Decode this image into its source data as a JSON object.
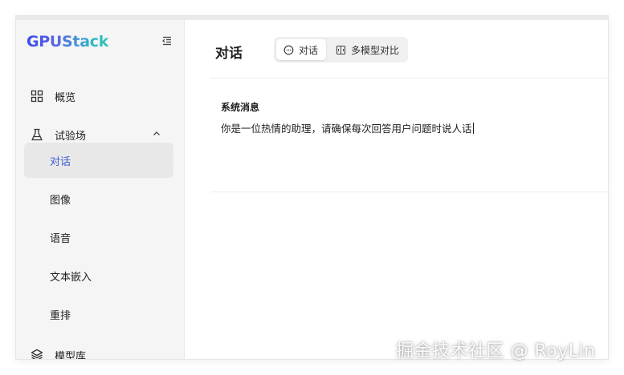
{
  "app": {
    "logo": "GPUStack"
  },
  "sidebar": {
    "items": [
      {
        "label": "概览",
        "icon": "grid-icon"
      },
      {
        "label": "试验场",
        "icon": "flask-icon",
        "expanded": true,
        "children": [
          {
            "label": "对话",
            "active": true
          },
          {
            "label": "图像"
          },
          {
            "label": "语音"
          },
          {
            "label": "文本嵌入"
          },
          {
            "label": "重排"
          }
        ]
      },
      {
        "label": "模型库",
        "icon": "layers-icon"
      }
    ]
  },
  "main": {
    "title": "对话",
    "tabs": [
      {
        "label": "对话",
        "icon": "chat-icon",
        "active": true
      },
      {
        "label": "多模型对比",
        "icon": "compare-icon",
        "active": false
      }
    ],
    "system_message": {
      "label": "系统消息",
      "value": "你是一位热情的助理，请确保每次回答用户问题时说人话"
    }
  },
  "watermark": "掘金技术社区 @ RoyLin",
  "colors": {
    "accent": "#3c5bd6",
    "sidebar_bg": "#f5f5f5",
    "active_item_bg": "#e8e8e8"
  }
}
